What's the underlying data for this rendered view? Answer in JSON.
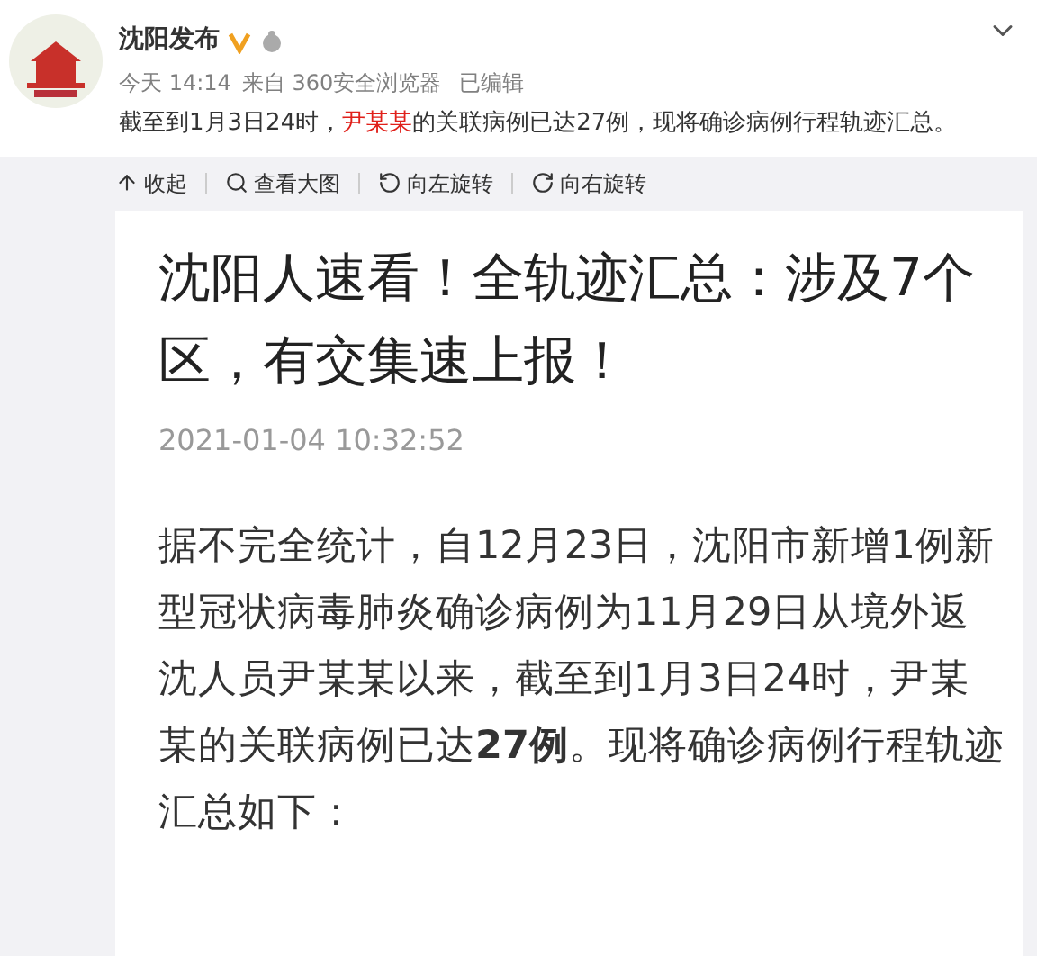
{
  "post": {
    "author": "沈阳发布",
    "meta": {
      "time": "今天 14:14",
      "source": "来自 360安全浏览器",
      "edited": "已编辑"
    },
    "text": [
      {
        "text": "截至到1月3日24时，",
        "highlight": false
      },
      {
        "text": "尹某某",
        "highlight": true
      },
      {
        "text": "的关联病例已达27例，现将确诊病例行程轨迹汇总。",
        "highlight": false
      }
    ]
  },
  "toolbar": [
    {
      "label": "收起",
      "kind": "collapse"
    },
    {
      "label": "查看大图",
      "kind": "zoom"
    },
    {
      "label": "向左旋转",
      "kind": "rotate-left"
    },
    {
      "label": "向右旋转",
      "kind": "rotate-right"
    }
  ],
  "article": {
    "title": "沈阳人速看！全轨迹汇总：涉及7个区，有交集速上报！",
    "date": "2021-01-04 10:32:52",
    "body": "据不完全统计，自12月23日，沈阳市新增1例新型冠状病毒肺炎确诊病例为11月29日从境外返沈人员尹某某以来，截至到1月3日24时，尹某某的关联病例已达**27例**。现将确诊病例行程轨迹汇总如下："
  }
}
